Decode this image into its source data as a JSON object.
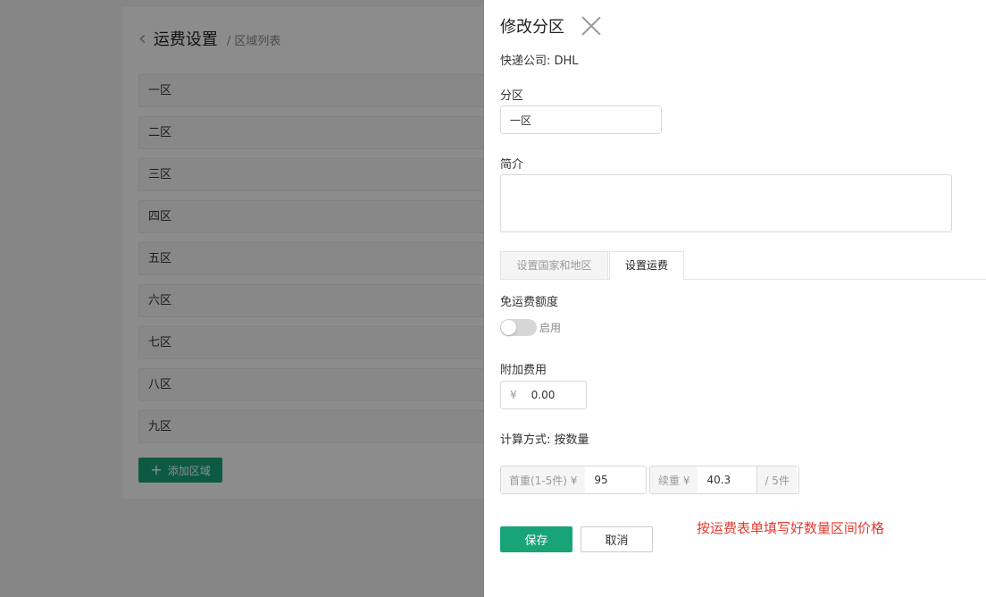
{
  "background": {
    "title": "运费设置",
    "subtitle": "/ 区域列表",
    "zones": [
      "一区",
      "二区",
      "三区",
      "四区",
      "五区",
      "六区",
      "七区",
      "八区",
      "九区"
    ],
    "add_button": "添加区域"
  },
  "drawer": {
    "title": "修改分区",
    "company": "快递公司: DHL",
    "zone_label": "分区",
    "zone_value": "一区",
    "intro_label": "简介",
    "intro_value": "",
    "tabs": [
      "设置国家和地区",
      "设置运费"
    ],
    "active_tab": "设置运费",
    "free_shipping_label": "免运费额度",
    "switch_label": "启用",
    "switch_on": false,
    "extra_fee_label": "附加费用",
    "currency": "¥",
    "extra_fee_value": "0.00",
    "calc_method": "计算方式: 按数量",
    "first_weight_label": "首重(1-5件) ¥",
    "first_weight_value": "95",
    "continued_weight_label": "续重 ¥",
    "continued_weight_value": "40.3",
    "continued_unit": "/ 5件",
    "save_label": "保存",
    "cancel_label": "取消"
  },
  "annotation": "按运费表单填写好数量区间价格",
  "colors": {
    "primary": "#19a478",
    "annotation": "#e03b2f"
  }
}
